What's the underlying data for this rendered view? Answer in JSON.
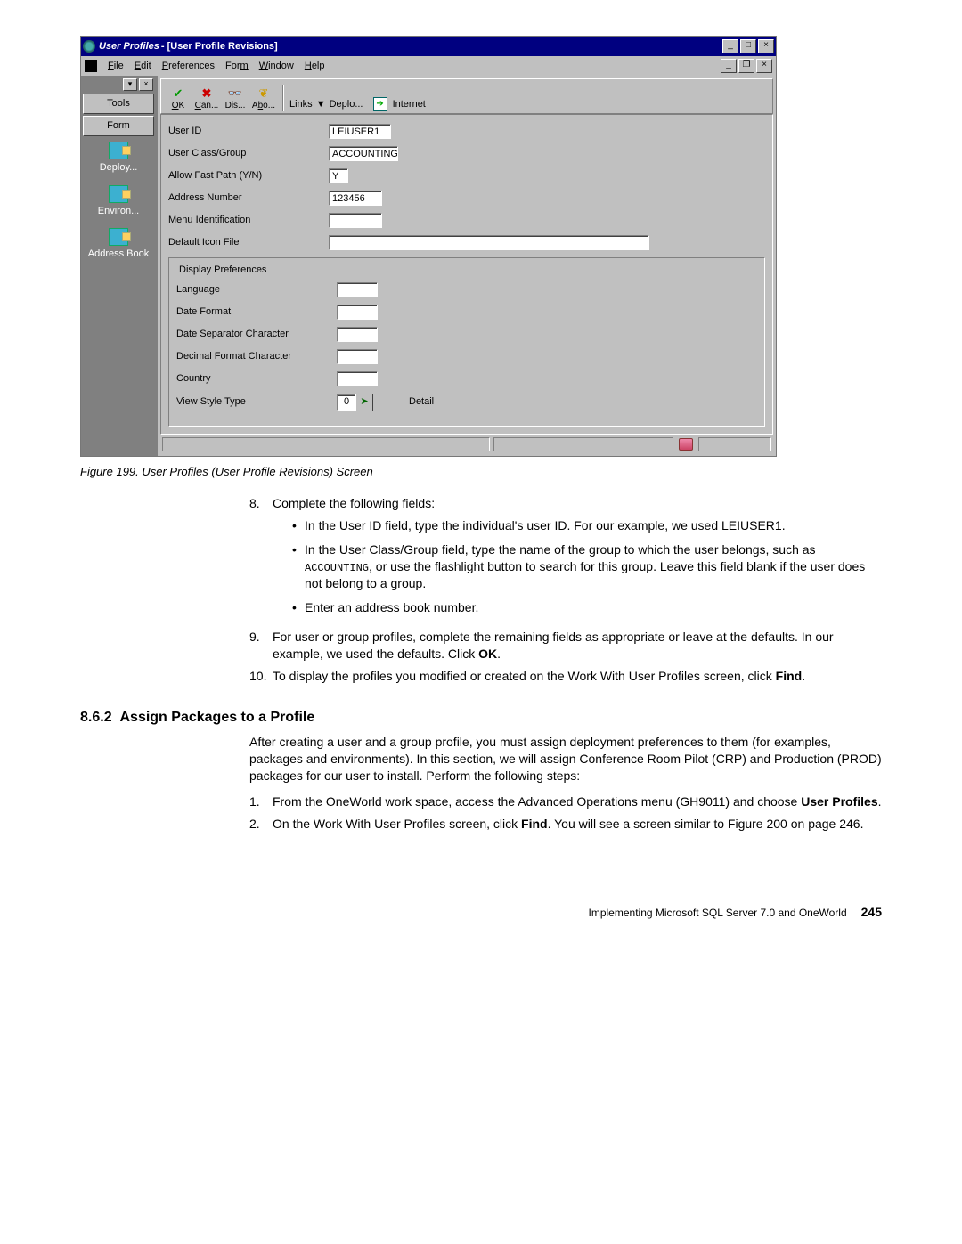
{
  "window": {
    "app_title": "User Profiles",
    "sub_title": " - [User Profile Revisions]",
    "menus": {
      "file": "File",
      "edit": "Edit",
      "preferences": "Preferences",
      "form": "Form",
      "window": "Window",
      "help": "Help"
    },
    "win_btns": {
      "min": "_",
      "max": "□",
      "close": "×",
      "restore": "❐"
    }
  },
  "sidebar": {
    "tabs": {
      "tools": "Tools",
      "form": "Form"
    },
    "items": [
      {
        "label": "Deploy..."
      },
      {
        "label": "Environ..."
      },
      {
        "label": "Address Book"
      }
    ]
  },
  "toolbar": {
    "ok": "OK",
    "cancel": "Can...",
    "display": "Dis...",
    "about": "Abo...",
    "links_label": "Links",
    "deploy": "Deplo...",
    "internet": "Internet"
  },
  "form": {
    "user_id": {
      "label": "User ID",
      "value": "LEIUSER1"
    },
    "user_class": {
      "label": "User Class/Group",
      "value": "ACCOUNTING"
    },
    "fast_path": {
      "label": "Allow Fast Path (Y/N)",
      "value": "Y"
    },
    "addr_num": {
      "label": "Address Number",
      "value": "123456"
    },
    "menu_id": {
      "label": "Menu Identification",
      "value": ""
    },
    "icon_file": {
      "label": "Default Icon File",
      "value": ""
    },
    "display_prefs": {
      "legend": "Display Preferences",
      "language": {
        "label": "Language",
        "value": ""
      },
      "date_format": {
        "label": "Date Format",
        "value": ""
      },
      "date_sep": {
        "label": "Date Separator Character",
        "value": ""
      },
      "dec_fmt": {
        "label": "Decimal Format Character",
        "value": ""
      },
      "country": {
        "label": "Country",
        "value": ""
      },
      "view_style": {
        "label": "View Style Type",
        "value": "0",
        "btn": "➤",
        "detail": "Detail"
      }
    }
  },
  "caption": "Figure 199.  User Profiles (User Profile Revisions) Screen",
  "steps_a": {
    "s8_num": "8.",
    "s8": "Complete the following fields:",
    "b1a": "In the User ID field, type the individual's user ID. For our example, we used LEIUSER1.",
    "b2a": "In the User Class/Group field, type the name of the group to which the user belongs, such as ",
    "b2m": "ACCOUNTING",
    "b2b": ", or use the flashlight button to search for this group. Leave this field blank if the user does not belong to a group.",
    "b3": "Enter an address book number.",
    "s9_num": "9.",
    "s9a": "For user or group profiles, complete the remaining fields as appropriate or leave at the defaults. In our example, we used the defaults. Click ",
    "s9b": "OK",
    "s9c": ".",
    "s10_num": "10.",
    "s10a": "To display the profiles you modified or created on the Work With User Profiles screen, click ",
    "s10b": "Find",
    "s10c": "."
  },
  "section": {
    "num": "8.6.2",
    "title": "Assign Packages to a Profile",
    "intro": "After creating a user and a group profile, you must assign deployment preferences to them (for examples, packages and environments). In this section, we will assign Conference Room Pilot (CRP) and Production (PROD) packages for our user to install. Perform the following steps:",
    "s1_num": "1.",
    "s1a": "From the OneWorld work space, access the Advanced Operations menu (GH9011) and choose ",
    "s1b": "User Profiles",
    "s1c": ".",
    "s2_num": "2.",
    "s2a": "On the Work With User Profiles screen, click ",
    "s2b": "Find",
    "s2c": ". You will see a screen similar to Figure 200 on page 246."
  },
  "footer": {
    "text": "Implementing Microsoft SQL Server 7.0 and OneWorld",
    "page": "245"
  }
}
